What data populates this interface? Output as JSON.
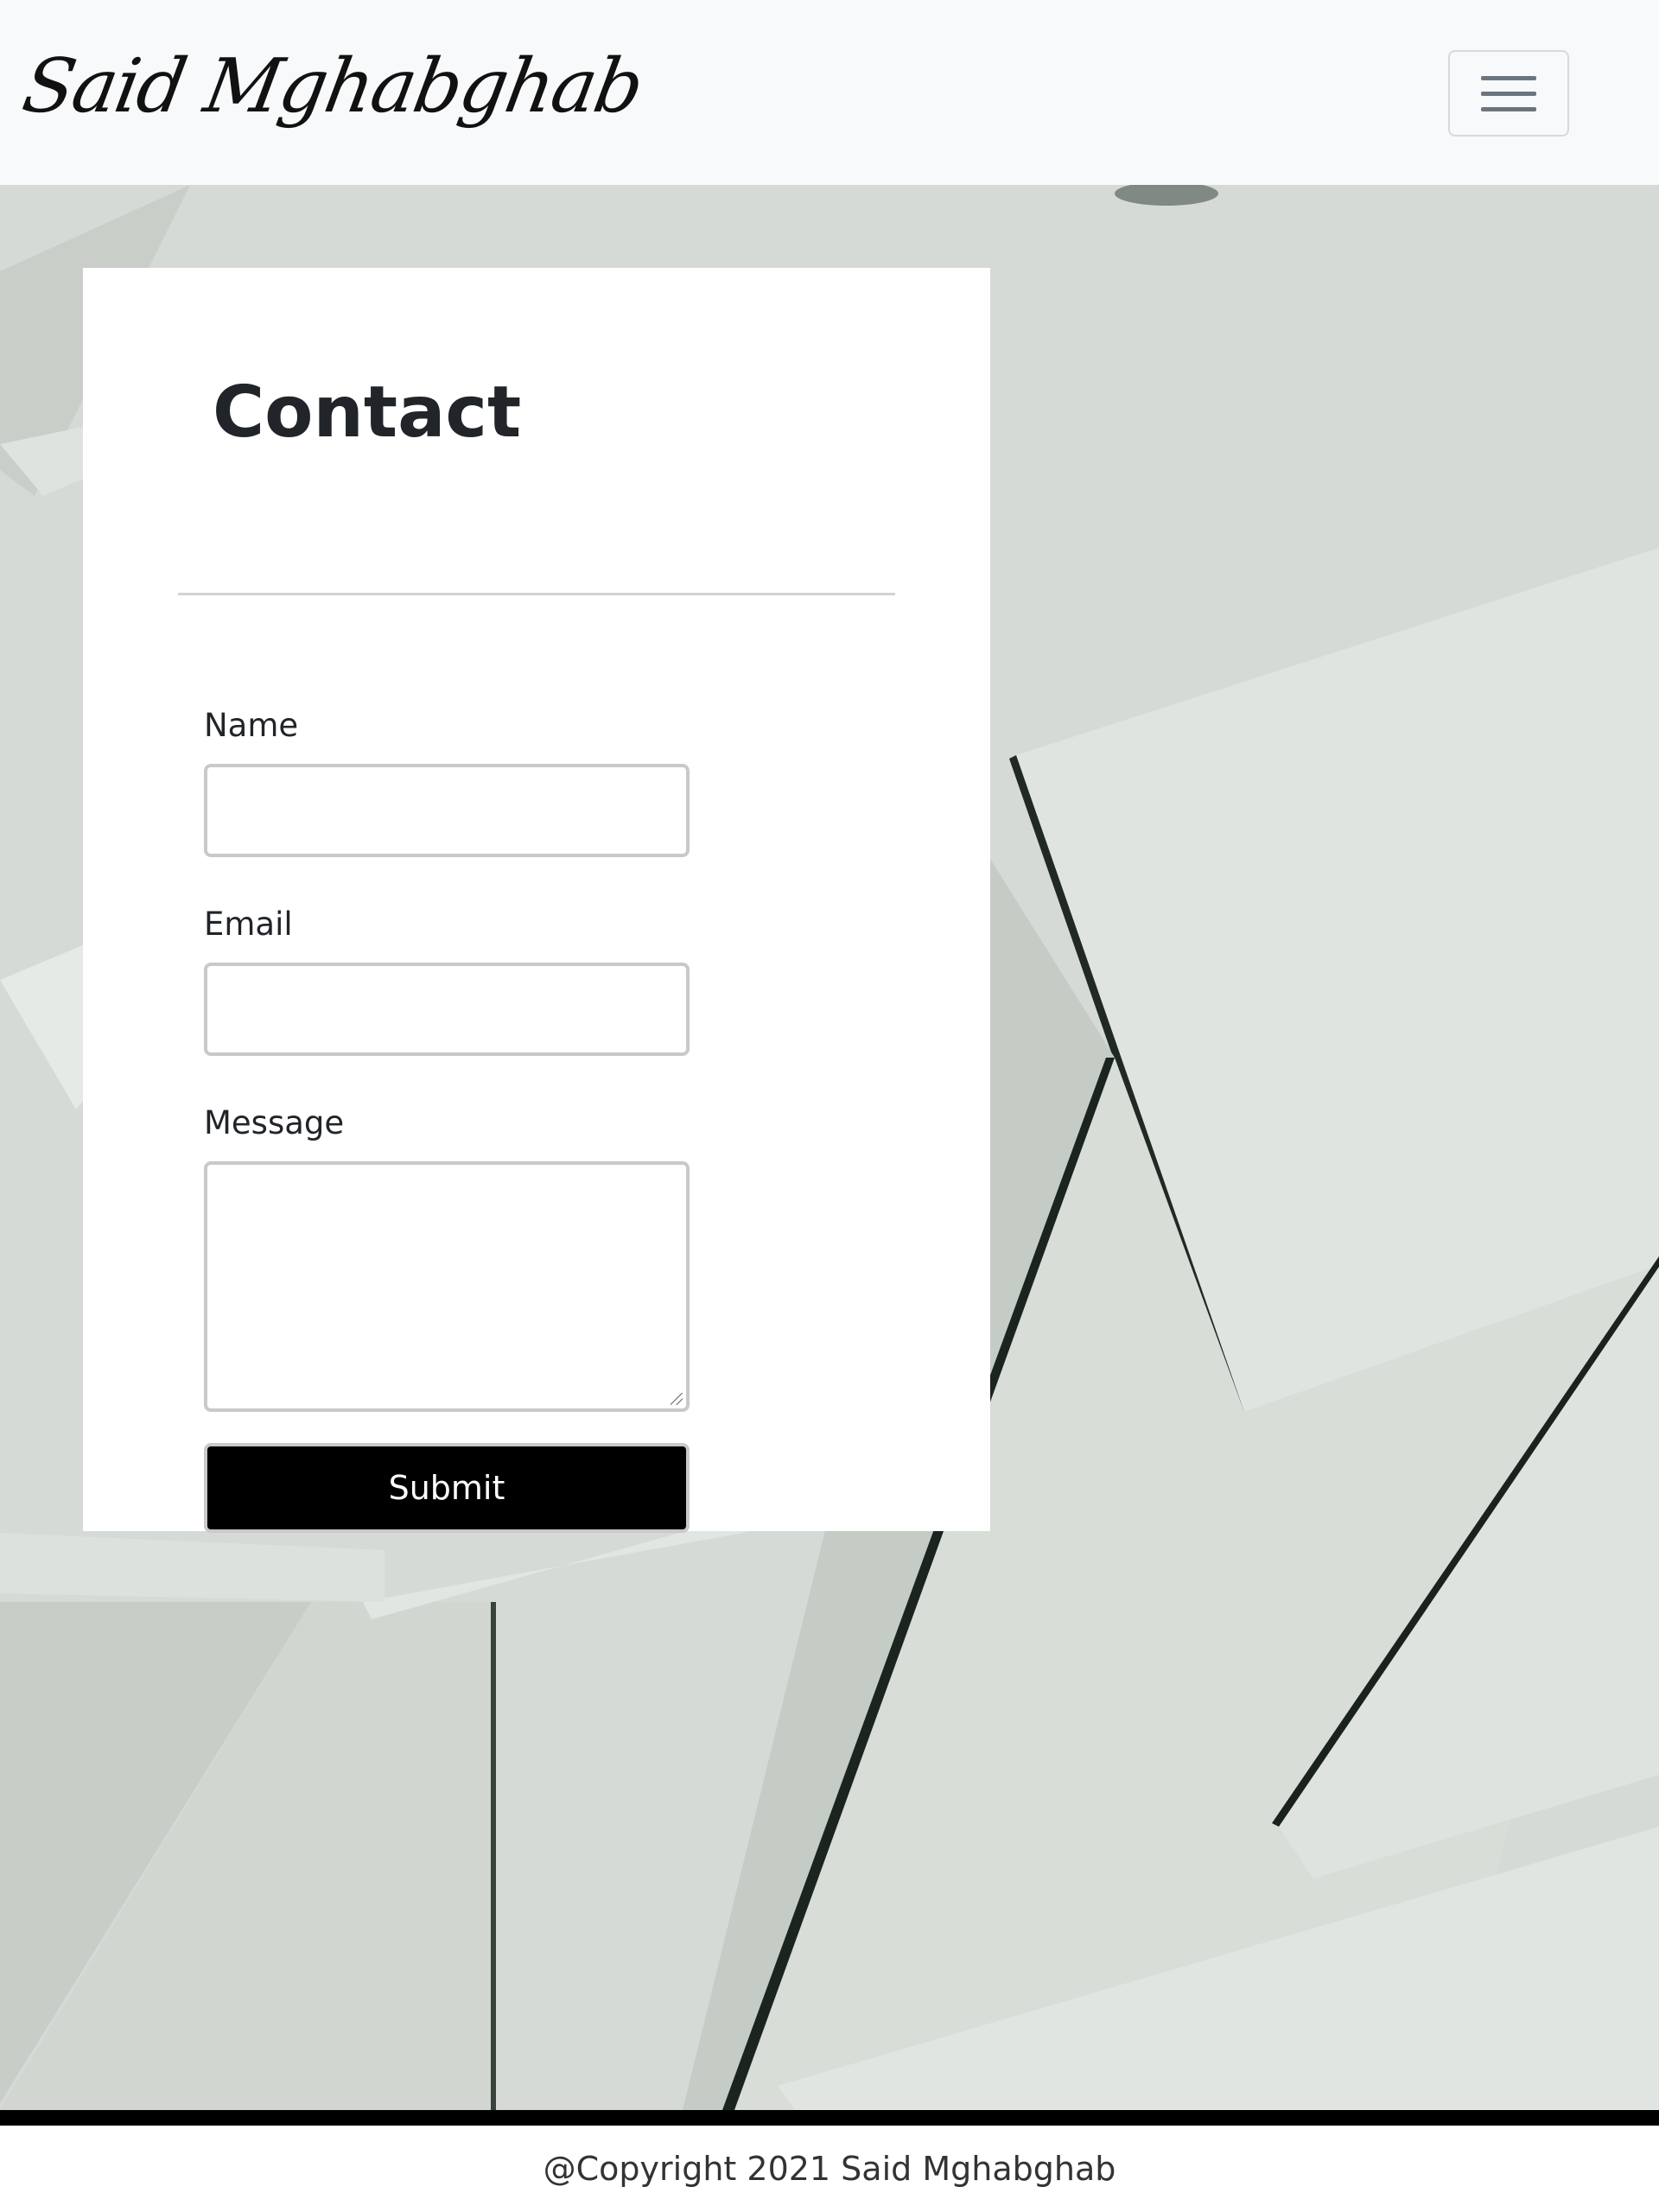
{
  "navbar": {
    "brand": "Said Mghabghab",
    "toggler_icon": "hamburger-icon"
  },
  "contact": {
    "title": "Contact",
    "name_label": "Name",
    "name_value": "",
    "email_label": "Email",
    "email_value": "",
    "message_label": "Message",
    "message_value": "",
    "submit_label": "Submit"
  },
  "footer": {
    "copyright": "@Copyright 2021 Said Mghabghab"
  },
  "colors": {
    "navbar_bg": "#f8f9fa",
    "submit_bg": "#000000",
    "submit_text": "#ffffff",
    "background_paper": "#d2d6d2"
  }
}
